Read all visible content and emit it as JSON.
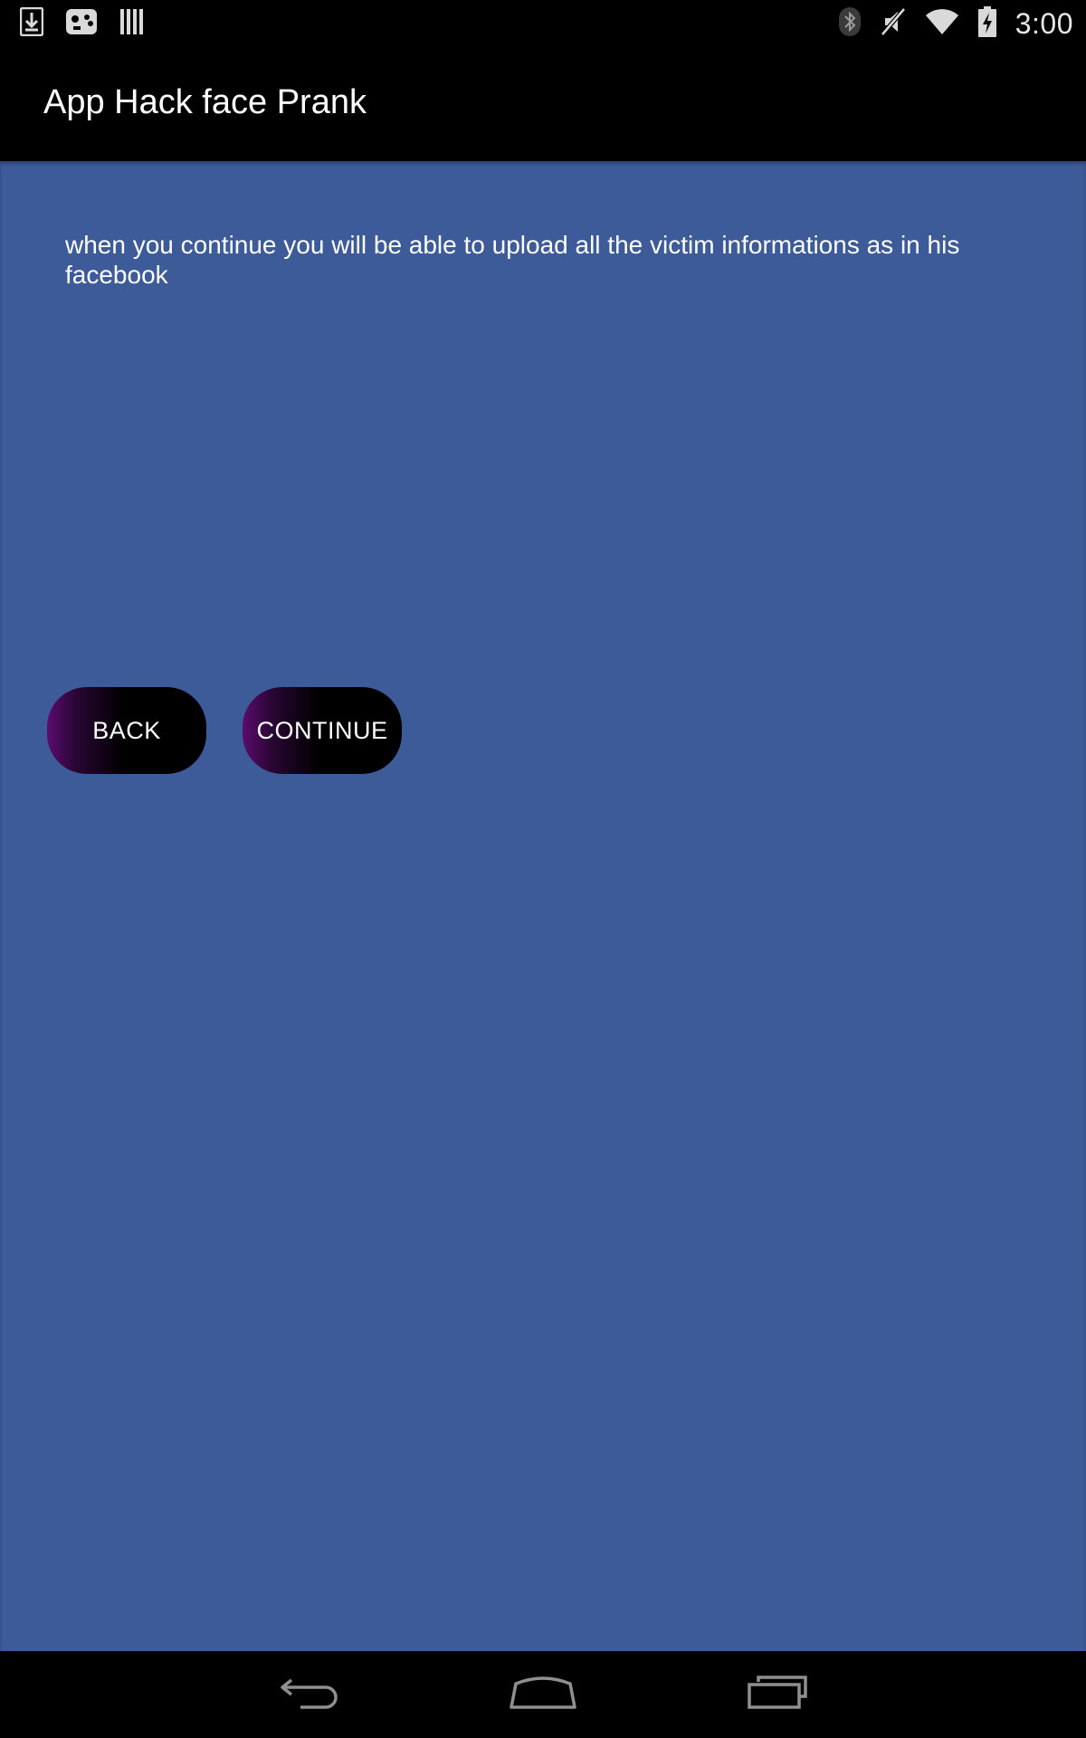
{
  "status_bar": {
    "time": "3:00",
    "left_icons": [
      "download-icon",
      "game-controller-icon",
      "barcode-icon"
    ],
    "right_icons": [
      "bluetooth-icon",
      "mute-icon",
      "wifi-icon",
      "battery-charging-icon"
    ]
  },
  "action_bar": {
    "title": "App Hack face Prank"
  },
  "main": {
    "message": "when you continue you will be able to upload all the victim informations as in his facebook",
    "back_label": "BACK",
    "continue_label": "CONTINUE"
  },
  "nav_bar": {
    "icons": [
      "back-arrow-icon",
      "home-icon",
      "recent-apps-icon"
    ]
  },
  "colors": {
    "content_background": "#3d5a99",
    "bars_background": "#000000",
    "button_gradient_accent": "#5b0c6e",
    "text": "#ffffff"
  }
}
